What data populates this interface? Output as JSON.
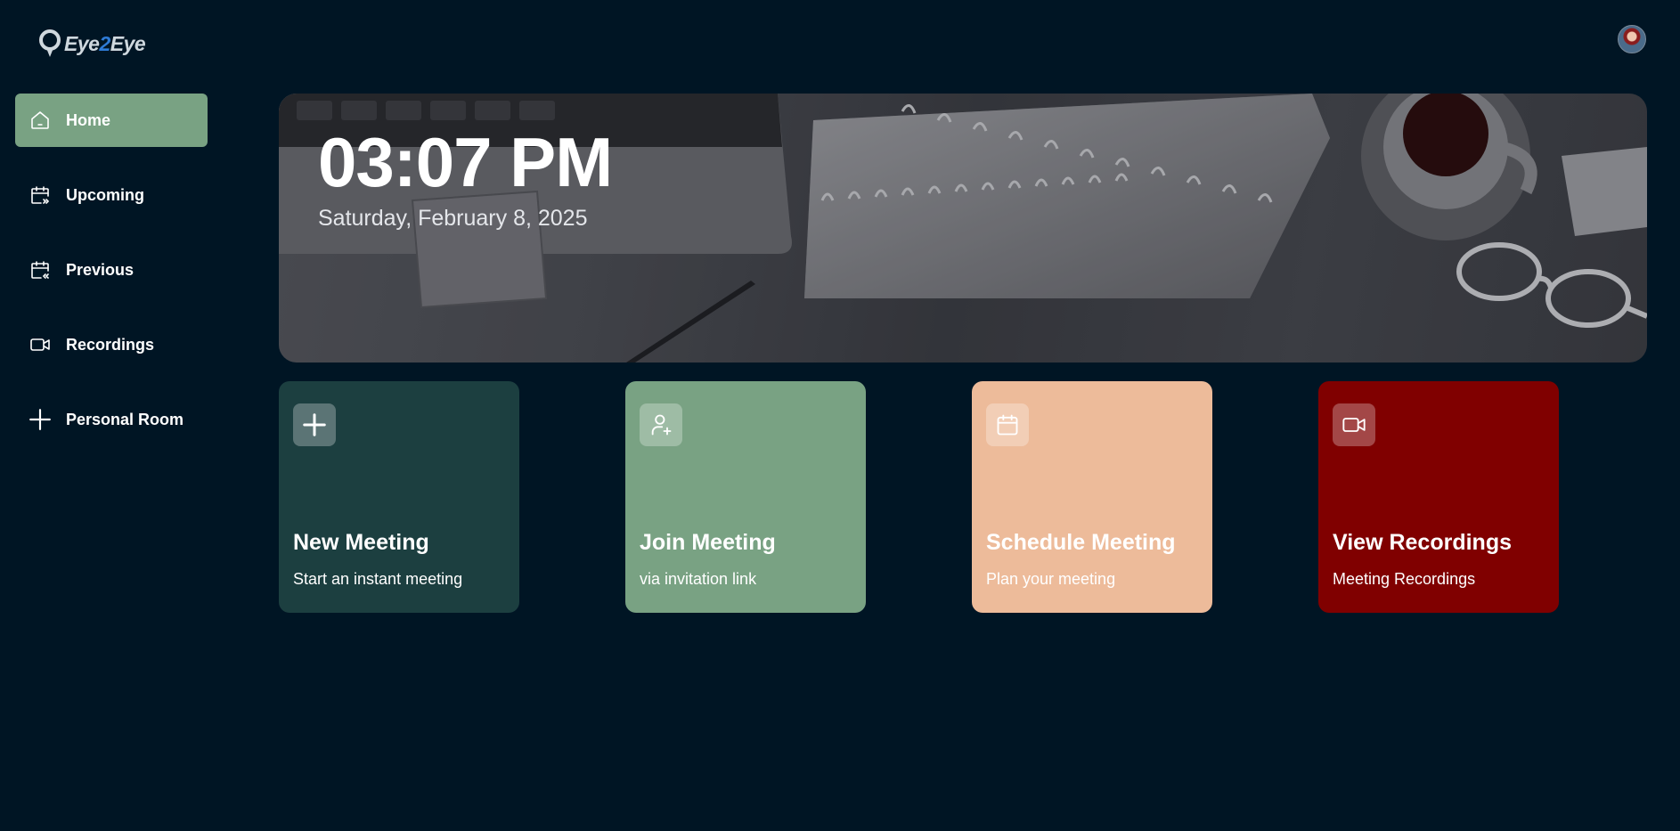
{
  "brand": {
    "logo_prefix": "Eye",
    "logo_mid": "2",
    "logo_suffix": "Eye"
  },
  "sidebar": {
    "items": [
      {
        "label": "Home",
        "icon": "home-icon",
        "active": true
      },
      {
        "label": "Upcoming",
        "icon": "calendar-upcoming-icon"
      },
      {
        "label": "Previous",
        "icon": "calendar-previous-icon"
      },
      {
        "label": "Recordings",
        "icon": "video-icon"
      },
      {
        "label": "Personal Room",
        "icon": "plus-icon"
      }
    ]
  },
  "hero": {
    "time": "03:07 PM",
    "date": "Saturday, February 8, 2025"
  },
  "cards": [
    {
      "title": "New Meeting",
      "subtitle": "Start an instant meeting",
      "icon": "plus-icon",
      "color": "#1c3f40"
    },
    {
      "title": "Join Meeting",
      "subtitle": "via invitation link",
      "icon": "user-add-icon",
      "color": "#79a283"
    },
    {
      "title": "Schedule Meeting",
      "subtitle": "Plan your meeting",
      "icon": "calendar-icon",
      "color": "#edbb9a"
    },
    {
      "title": "View Recordings",
      "subtitle": "Meeting Recordings",
      "icon": "video-icon",
      "color": "#800000"
    }
  ],
  "colors": {
    "background": "#001524",
    "accent": "#79a283"
  }
}
